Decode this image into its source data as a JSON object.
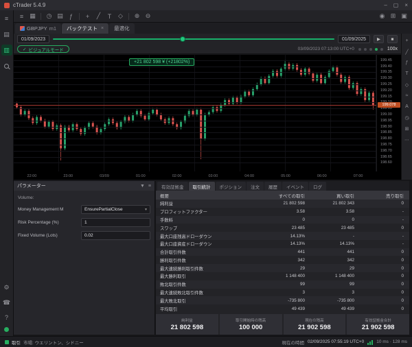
{
  "window": {
    "title": "cTrader 5.4.9",
    "controls": {
      "minimize": "–",
      "maximize": "▢",
      "close": "×"
    }
  },
  "toolbar": {
    "left": [
      {
        "name": "menu-icon",
        "glyph": "≡"
      },
      {
        "name": "symbol-grid-icon",
        "glyph": "▦"
      },
      {
        "sep": true
      },
      {
        "name": "timeframe-icon",
        "glyph": "◷"
      },
      {
        "name": "chart-type-icon",
        "glyph": "▤"
      },
      {
        "name": "indicators-icon",
        "glyph": "ƒ"
      },
      {
        "sep": true
      },
      {
        "name": "crosshair-icon",
        "glyph": "+"
      },
      {
        "name": "trendline-icon",
        "glyph": "╱"
      },
      {
        "name": "text-tool-icon",
        "glyph": "T"
      },
      {
        "name": "shapes-icon",
        "glyph": "◇"
      },
      {
        "sep": true
      },
      {
        "name": "zoom-in-icon",
        "glyph": "⊕"
      },
      {
        "name": "zoom-out-icon",
        "glyph": "⊖"
      }
    ],
    "right": [
      {
        "name": "alerts-icon",
        "glyph": "◉"
      },
      {
        "name": "layout-grid-icon",
        "glyph": "⊞"
      },
      {
        "name": "panel-toggle-icon",
        "glyph": "▣"
      }
    ]
  },
  "left_strip": {
    "top": [
      {
        "name": "sidebar-menu-icon",
        "glyph": "≡"
      },
      {
        "name": "sidebar-watchlist-icon",
        "glyph": "▤"
      },
      {
        "name": "sidebar-chart-icon",
        "glyph": "▥",
        "active": true
      },
      {
        "name": "sidebar-search-icon",
        "search": true
      }
    ],
    "bottom": [
      {
        "name": "settings-gear-icon",
        "glyph": "⚙"
      },
      {
        "name": "support-phone-icon",
        "glyph": "☎"
      },
      {
        "name": "help-icon",
        "glyph": "?"
      }
    ]
  },
  "right_strip": [
    {
      "name": "crosshair-tool-icon",
      "glyph": "+"
    },
    {
      "name": "trendline-tool-icon",
      "glyph": "╱"
    },
    {
      "name": "indicator-tool-icon",
      "glyph": "ƒ"
    },
    {
      "name": "text-annotation-icon",
      "glyph": "T"
    },
    {
      "name": "shape-tool-icon",
      "glyph": "◇"
    },
    {
      "name": "fibonacci-tool-icon",
      "glyph": "≈"
    },
    {
      "name": "label-tool-icon",
      "glyph": "A"
    },
    {
      "name": "clock-tool-icon",
      "glyph": "◷"
    },
    {
      "name": "grid-tool-icon",
      "glyph": "⊞"
    },
    {
      "name": "more-tools-icon",
      "glyph": "⋯"
    }
  ],
  "tabs": {
    "symbol": {
      "label": "GBPJPY",
      "period": "m1"
    },
    "backtest": "バックテスト",
    "optimize": "最適化",
    "close_glyph": "×"
  },
  "controls": {
    "start_date": "01/09/2023",
    "end_date": "01/09/2025",
    "play_glyph": "▶",
    "stop_glyph": "■",
    "visual_check": "✓",
    "visual_mode": "ビジュアルモード",
    "backtest_time": "03/09/2023 07:13:00 UTC+0",
    "speed": "100x"
  },
  "chart": {
    "tooltip": "+21 802 598 ¥ (+21802%)",
    "current_price": "199.078",
    "price_line": 199.078,
    "pmax": 199.46,
    "pmin": 198.58,
    "axis_labels": [
      "199.45",
      "199.40",
      "199.35",
      "199.30",
      "199.25",
      "199.20",
      "199.15",
      "199.10",
      "199.05",
      "199.00",
      "198.95",
      "198.90",
      "198.85",
      "198.80",
      "198.75",
      "198.70",
      "198.65",
      "198.60"
    ],
    "time_labels": [
      "22:00",
      "23:00",
      "03/09",
      "01:00",
      "02:00",
      "03:00",
      "04:00",
      "05:00",
      "06:00",
      "07:00"
    ],
    "open0": 199.09,
    "closes": [
      199.06,
      199.0,
      199.03,
      198.97,
      198.93,
      198.98,
      198.95,
      198.9,
      198.94,
      198.88,
      198.91,
      198.72,
      198.9,
      198.87,
      198.92,
      198.88,
      198.84,
      198.89,
      198.93,
      198.9,
      198.85,
      198.88,
      198.92,
      198.96,
      198.93,
      198.89,
      198.94,
      198.98,
      198.95,
      199.0,
      199.03,
      198.99,
      198.96,
      199.01,
      199.04,
      199.0,
      198.96,
      198.93,
      198.97,
      198.92,
      198.89,
      198.94,
      198.99,
      199.03,
      199.0,
      199.04,
      198.8,
      199.0,
      199.02,
      199.06,
      199.03,
      199.08,
      199.12,
      199.09,
      199.14,
      199.1,
      199.15,
      199.19,
      199.16,
      199.21,
      199.25,
      199.3,
      199.26,
      199.32,
      199.36,
      199.32,
      199.38,
      199.42,
      199.38,
      199.41,
      199.37,
      199.33,
      199.38,
      199.34,
      199.28,
      199.33,
      199.26,
      199.31,
      199.36,
      199.39,
      199.33,
      199.27,
      199.31,
      199.22,
      199.26,
      199.17,
      199.21,
      199.12,
      199.18,
      199.08
    ],
    "wick_overrides": [
      {
        "i": 11,
        "low": 198.62
      },
      {
        "i": 46,
        "low": 198.63
      },
      {
        "i": 67,
        "high": 199.45
      },
      {
        "i": 89,
        "low": 199.04
      }
    ],
    "colors": {
      "up": "#27a06a",
      "down": "#d9534f"
    }
  },
  "parameters": {
    "title": "パラメーター",
    "header_icons": [
      {
        "name": "save-parameters-icon",
        "glyph": "▼"
      },
      {
        "name": "parameters-menu-icon",
        "glyph": "≡"
      }
    ],
    "group": "Volume:",
    "fields": [
      {
        "label": "Money Management M",
        "value": "EnsurePartialClose",
        "type": "select"
      },
      {
        "label": "Risk Percentage (%)",
        "value": "1",
        "type": "input"
      },
      {
        "label": "Fixed Volume (Lots)",
        "value": "0.02",
        "type": "input"
      }
    ]
  },
  "stats": {
    "tabs": [
      "有効証拠金",
      "取引統計",
      "ポジション",
      "注文",
      "履歴",
      "イベント",
      "ログ"
    ],
    "active_tab": "取引統計",
    "columns": [
      "概要",
      "すべての取引",
      "買い取引",
      "売り取引"
    ],
    "rows": [
      [
        "純利益",
        "21 802 598",
        "21 802 343",
        "0"
      ],
      [
        "プロフィットファクター",
        "3.58",
        "3.58",
        "-"
      ],
      [
        "手数料",
        "0",
        "0",
        "-"
      ],
      [
        "スワップ",
        "23 485",
        "23 485",
        "0"
      ],
      [
        "最大口座残高ドローダウン",
        "14.13%",
        "-",
        "-"
      ],
      [
        "最大口座資産ドローダウン",
        "14.13%",
        "14.13%",
        "-"
      ],
      [
        "合計取引件数",
        "441",
        "441",
        "0"
      ],
      [
        "勝利取引件数",
        "342",
        "342",
        "0"
      ],
      [
        "最大連続勝利取引件数",
        "29",
        "29",
        "0"
      ],
      [
        "最大勝利取引",
        "1 148 400",
        "1 148 400",
        "0"
      ],
      [
        "敗北取引件数",
        "99",
        "99",
        "0"
      ],
      [
        "最大連続敗北取引件数",
        "3",
        "3",
        "0"
      ],
      [
        "最大敗北取引",
        "-735 800",
        "-735 800",
        "0"
      ],
      [
        "平均取引",
        "49 439",
        "49 439",
        "0"
      ]
    ],
    "summary": [
      {
        "label": "純利益",
        "value": "21 802 598"
      },
      {
        "label": "取引開始時の残高",
        "value": "100 000"
      },
      {
        "label": "現在の残高",
        "value": "21 902 598"
      },
      {
        "label": "有効証拠金合計",
        "value": "21 902 598"
      }
    ]
  },
  "status_bar": {
    "mode": "取引",
    "market": "市場: ウエリントン、シドニー",
    "time_label": "現在の時間",
    "time": "02/09/2025 07:55:19 UTC+0",
    "latency": "10 ms · 128 ms"
  }
}
